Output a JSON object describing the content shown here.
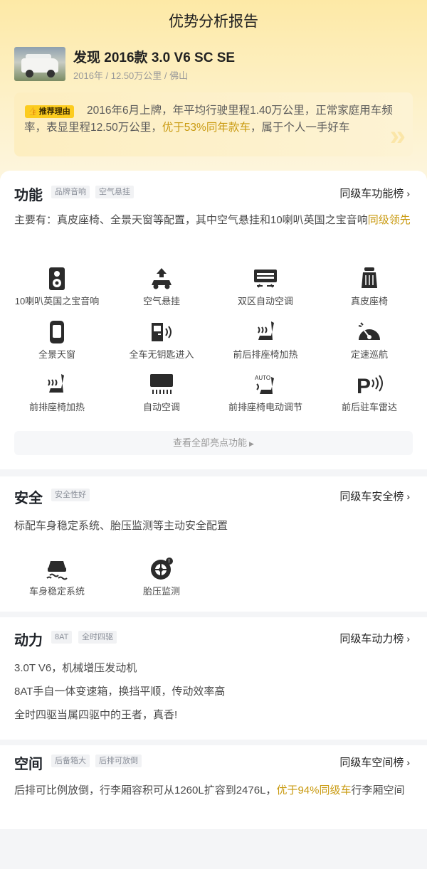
{
  "page": {
    "title": "优势分析报告"
  },
  "car": {
    "name": "发现 2016款 3.0 V6 SC SE",
    "meta": "2016年 / 12.50万公里 / 佛山"
  },
  "reason": {
    "badge": "推荐理由",
    "text_before": "2016年6月上牌，年平均行驶里程1.40万公里，正常家庭用车频率，表显里程12.50万公里，",
    "highlight": "优于53%同年款车",
    "text_after": "，属于个人一手好车"
  },
  "sections": {
    "function": {
      "title": "功能",
      "tags": [
        "品牌音响",
        "空气悬挂"
      ],
      "rank": "同级车功能榜",
      "desc": "主要有：真皮座椅、全景天窗等配置，其中空气悬挂和10喇叭英国之宝音响",
      "desc_highlight": "同级领先",
      "features": [
        {
          "label": "10喇叭英国之宝音响",
          "icon": "speaker-icon"
        },
        {
          "label": "空气悬挂",
          "icon": "air-suspension-icon"
        },
        {
          "label": "双区自动空调",
          "icon": "dual-zone-ac-icon"
        },
        {
          "label": "真皮座椅",
          "icon": "leather-seat-icon"
        },
        {
          "label": "全景天窗",
          "icon": "panoramic-sunroof-icon"
        },
        {
          "label": "全车无钥匙进入",
          "icon": "keyless-entry-icon"
        },
        {
          "label": "前后排座椅加热",
          "icon": "seat-heating-all-icon"
        },
        {
          "label": "定速巡航",
          "icon": "cruise-control-icon"
        },
        {
          "label": "前排座椅加热",
          "icon": "front-seat-heating-icon"
        },
        {
          "label": "自动空调",
          "icon": "auto-ac-icon"
        },
        {
          "label": "前排座椅电动调节",
          "icon": "power-seat-icon"
        },
        {
          "label": "前后驻车雷达",
          "icon": "parking-radar-icon"
        }
      ],
      "see_all": "查看全部亮点功能"
    },
    "safety": {
      "title": "安全",
      "tags": [
        "安全性好"
      ],
      "rank": "同级车安全榜",
      "desc": "标配车身稳定系统、胎压监测等主动安全配置",
      "features": [
        {
          "label": "车身稳定系统",
          "icon": "stability-control-icon"
        },
        {
          "label": "胎压监测",
          "icon": "tire-pressure-icon"
        }
      ]
    },
    "power": {
      "title": "动力",
      "tags": [
        "8AT",
        "全时四驱"
      ],
      "rank": "同级车动力榜",
      "lines": [
        "3.0T V6，机械增压发动机",
        "8AT手自一体变速箱，换挡平顺，传动效率高",
        "全时四驱当属四驱中的王者，真香!"
      ]
    },
    "space": {
      "title": "空间",
      "tags": [
        "后备箱大",
        "后排可放倒"
      ],
      "rank": "同级车空间榜",
      "desc": "后排可比例放倒，行李厢容积可从1260L扩容到2476L，",
      "desc_highlight": "优于94%同级车",
      "desc_after": "行李厢空间"
    }
  },
  "colors": {
    "accent": "#c99a10",
    "badge": "#fccc1f",
    "header_bg": "#fde9a6"
  }
}
